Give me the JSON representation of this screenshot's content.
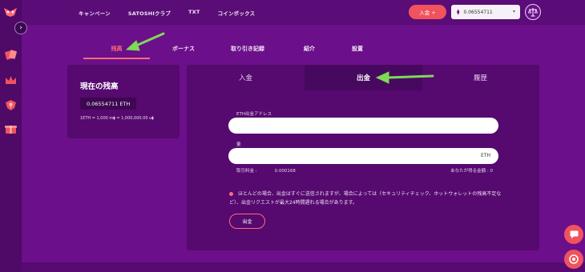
{
  "topnav": {
    "items": [
      "キャンペーン",
      "SATOSHIクラブ",
      "TXT",
      "コインボックス"
    ]
  },
  "header": {
    "deposit_label": "入金 +",
    "balance_value": "0.06554711"
  },
  "account_tabs": {
    "items": [
      "残高",
      "ボーナス",
      "取り引き記録",
      "紹介",
      "設置"
    ],
    "active": "残高"
  },
  "balance_panel": {
    "title": "現在の残高",
    "amount": "0.06554711 ETH",
    "rate": "1ETH = 1,000 m⧫ = 1,000,000.00 u⧫"
  },
  "main_tabs": {
    "items": [
      "入金",
      "出金",
      "履歴"
    ],
    "active": "出金"
  },
  "withdraw_form": {
    "address_label": "ETH出金アドレス",
    "amount_label": "量",
    "amount_unit": "ETH",
    "fee_label": "取引料金 :",
    "fee_value": "0.000168",
    "receive_label": "あなたが得る金額 :",
    "receive_value": "0",
    "notice": "ほとんどの場合、出金はすぐに送信されますが、場合によっては（セキュリティチェック、ホットウォレットの残高不足など）、出金リクエストが最大24時間遅れる場合があります。",
    "submit_label": "出金"
  },
  "colors": {
    "background": "#6b0f8a",
    "accent": "#ff6c7a",
    "annotation_arrow": "#7ed957"
  },
  "icons": [
    "logo-icon",
    "chevron-right-icon",
    "cards-icon",
    "crown-icon",
    "shield-icon",
    "gift-box-icon",
    "ethereum-icon",
    "chevron-down-icon",
    "balance-scale-icon",
    "chat-icon",
    "support-icon"
  ]
}
